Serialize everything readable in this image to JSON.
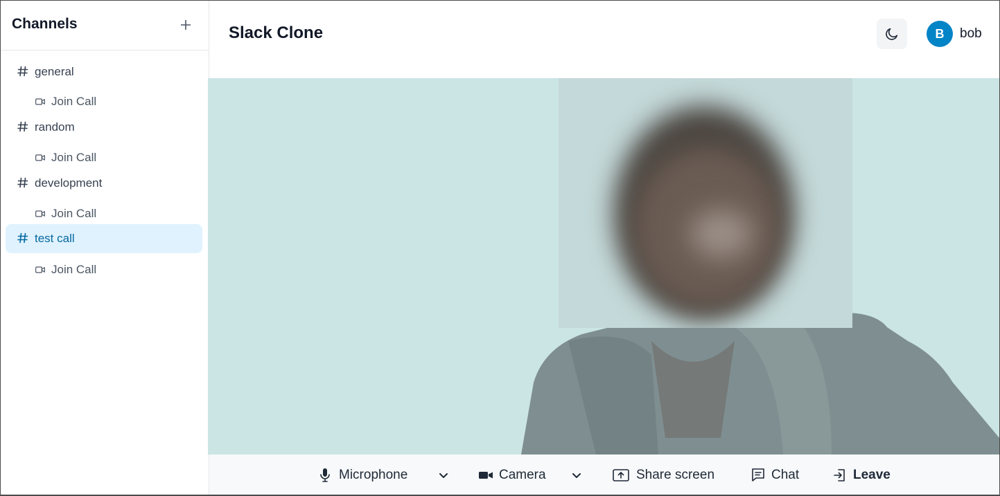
{
  "sidebar": {
    "title": "Channels",
    "channels": [
      {
        "name": "general",
        "join_label": "Join Call",
        "active": false
      },
      {
        "name": "random",
        "join_label": "Join Call",
        "active": false
      },
      {
        "name": "development",
        "join_label": "Join Call",
        "active": false
      },
      {
        "name": "test call",
        "join_label": "Join Call",
        "active": true
      }
    ]
  },
  "header": {
    "app_title": "Slack Clone",
    "user": {
      "initial": "B",
      "name": "bob"
    }
  },
  "call_controls": {
    "microphone_label": "Microphone",
    "camera_label": "Camera",
    "share_screen_label": "Share screen",
    "chat_label": "Chat",
    "leave_label": "Leave"
  },
  "colors": {
    "accent": "#0284c7",
    "active_channel_bg": "#e0f2fe",
    "video_bg": "#cbe5e4",
    "controls_bg": "#f7f9fa"
  },
  "icons": [
    "plus-icon",
    "hash-icon",
    "video-camera-icon",
    "moon-icon",
    "microphone-icon",
    "chevron-down-icon",
    "camera-icon",
    "share-screen-icon",
    "chat-icon",
    "leave-icon"
  ]
}
